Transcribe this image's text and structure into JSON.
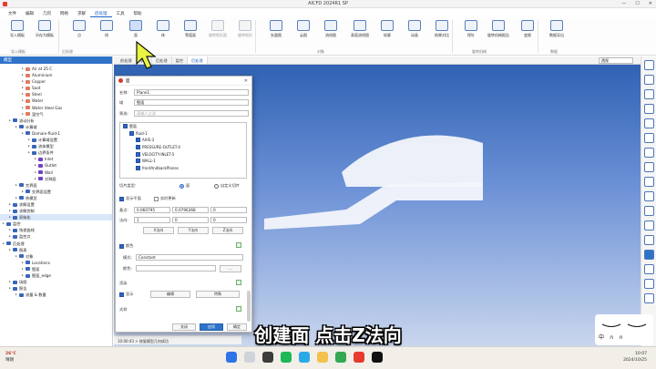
{
  "window": {
    "title": "AICFD 2024R1 SP"
  },
  "menu": [
    "文件",
    "编辑",
    "几何",
    "网格",
    "求解",
    "后处理",
    "工具",
    "帮助"
  ],
  "ribbon": {
    "buttons": [
      {
        "label": "导入模板",
        "dim": false
      },
      {
        "label": "另存为模板",
        "dim": false
      },
      {
        "label": "点",
        "dim": false
      },
      {
        "label": "线",
        "dim": false
      },
      {
        "label": "面",
        "dim": false,
        "selected": true
      },
      {
        "label": "体",
        "dim": false
      },
      {
        "label": "等值面",
        "dim": false
      },
      {
        "label": "旋转矩形面",
        "dim": true
      },
      {
        "label": "旋转矩形",
        "dim": true
      },
      {
        "label": "矢量图",
        "dim": false
      },
      {
        "label": "云图",
        "dim": false
      },
      {
        "label": "流线图",
        "dim": false
      },
      {
        "label": "表面流线图",
        "dim": false
      },
      {
        "label": "轮廓",
        "dim": false
      },
      {
        "label": "动画",
        "dim": false
      },
      {
        "label": "结果对比",
        "dim": false
      },
      {
        "label": "探针",
        "dim": false
      },
      {
        "label": "旋转机械报告",
        "dim": false
      },
      {
        "label": "变换",
        "dim": false
      },
      {
        "label": "数据导出",
        "dim": false
      }
    ],
    "groups": [
      "导入模板",
      "后处理",
      "对象",
      "旋转机械",
      "数据"
    ]
  },
  "left_panel": {
    "header": "模型",
    "tree": [
      {
        "label": "Air at 25 C",
        "level": 3,
        "color": "#e07a5f"
      },
      {
        "label": "Aluminium",
        "level": 3,
        "color": "#e07a5f"
      },
      {
        "label": "Copper",
        "level": 3,
        "color": "#e07a5f"
      },
      {
        "label": "Soot",
        "level": 3,
        "color": "#e07a5f"
      },
      {
        "label": "Steel",
        "level": 3,
        "color": "#e07a5f"
      },
      {
        "label": "Water",
        "level": 3,
        "color": "#e07a5f"
      },
      {
        "label": "Water Ideal Gas",
        "level": 3,
        "color": "#e07a5f"
      },
      {
        "label": "湿空气",
        "level": 3,
        "color": "#e07a5f"
      },
      {
        "label": "流动分析",
        "level": 1,
        "color": "#3a66b8"
      },
      {
        "label": "计算域",
        "level": 2,
        "color": "#3a66b8"
      },
      {
        "label": "Domain-fluid-1",
        "level": 3,
        "color": "#3a66b8"
      },
      {
        "label": "计算域设置",
        "level": 4,
        "color": "#3a66b8"
      },
      {
        "label": "流体模型",
        "level": 4,
        "color": "#3a66b8"
      },
      {
        "label": "边界条件",
        "level": 4,
        "color": "#3a66b8"
      },
      {
        "label": "Inlet",
        "level": 5,
        "color": "#6f42c1"
      },
      {
        "label": "Outlet",
        "level": 5,
        "color": "#6f42c1"
      },
      {
        "label": "Wall",
        "level": 5,
        "color": "#6f42c1"
      },
      {
        "label": "对称面",
        "level": 5,
        "color": "#6f42c1"
      },
      {
        "label": "交界面",
        "level": 2,
        "color": "#3a66b8"
      },
      {
        "label": "交界面设置",
        "level": 3,
        "color": "#3a66b8"
      },
      {
        "label": "热模型",
        "level": 2,
        "color": "#3a66b8"
      },
      {
        "label": "求解设置",
        "level": 1,
        "color": "#3a66b8"
      },
      {
        "label": "求解控制",
        "level": 1,
        "color": "#3a66b8"
      },
      {
        "label": "初始化",
        "level": 1,
        "color": "#3a66b8",
        "selected": true
      },
      {
        "label": "监控",
        "level": 0,
        "color": "#3a66b8"
      },
      {
        "label": "残差曲线",
        "level": 1,
        "color": "#3a66b8"
      },
      {
        "label": "监控点",
        "level": 1,
        "color": "#3a66b8"
      },
      {
        "label": "后处理",
        "level": 0,
        "color": "#3a66b8"
      },
      {
        "label": "图表",
        "level": 1,
        "color": "#3a66b8"
      },
      {
        "label": "对象",
        "level": 2,
        "color": "#3a66b8"
      },
      {
        "label": "Locations",
        "level": 3,
        "color": "#3a66b8"
      },
      {
        "label": "壁面",
        "level": 3,
        "color": "#3a66b8"
      },
      {
        "label": "壁面_edge",
        "level": 3,
        "color": "#3a66b8"
      },
      {
        "label": "场图",
        "level": 1,
        "color": "#3a66b8"
      },
      {
        "label": "报告",
        "level": 1,
        "color": "#3a66b8"
      },
      {
        "label": "流量 & 数量",
        "level": 2,
        "color": "#3a66b8"
      }
    ]
  },
  "viewport": {
    "tabs": [
      "前处理",
      "求解",
      "后处理",
      "监控",
      "后处理"
    ],
    "active_tab": 4,
    "view_combo": "透视"
  },
  "dialog": {
    "name_label": "名称:",
    "name_value": "Plane1",
    "domain_label": "域",
    "domain_value": "壁面",
    "filter_label": "筛选:",
    "filter_placeholder": "请输入过滤",
    "list": [
      {
        "label": "壁面",
        "level": 0
      },
      {
        "label": "fluid-1",
        "level": 1
      },
      {
        "label": "AXIS-3",
        "level": 2
      },
      {
        "label": "PRESSURE-OUTLET-4",
        "level": 2
      },
      {
        "label": "VELOCITY-INLET-5",
        "level": 2
      },
      {
        "label": "WALL-1",
        "level": 2
      },
      {
        "label": "frontAndbackPlanes",
        "level": 2
      }
    ],
    "slice_label": "切片类型:",
    "slice_options": [
      "面",
      "自定义切片"
    ],
    "show_plane": "显示平面",
    "auto_update": "实时更新",
    "point_label": "基点:",
    "point_values": [
      "0.060795",
      "0.0796368",
      "0"
    ],
    "normal_label": "法向:",
    "normal_values": [
      "1",
      "0",
      "0"
    ],
    "dir_buttons": [
      "X法向",
      "Y法向",
      "Z法向"
    ],
    "color_section": "颜色",
    "mode_label": "模式:",
    "mode_value": "Constant",
    "color_field_label": "颜色:",
    "display_section": "渲染",
    "show_label": "显示",
    "edit_btn": "编辑",
    "more_btn": "特殊",
    "style_section": "式样",
    "buttons": {
      "close": "关闭",
      "apply": "应用",
      "ok": "确定"
    }
  },
  "status": "10:00:43 > 修复模型几何成功",
  "subtitle": "创建面 点击Z法向",
  "watermark": "中 ∩ ∩",
  "taskbar": {
    "weather_temp": "26°C",
    "weather_desc": "晴朗",
    "time": "10:07",
    "date": "2024/10/25"
  }
}
